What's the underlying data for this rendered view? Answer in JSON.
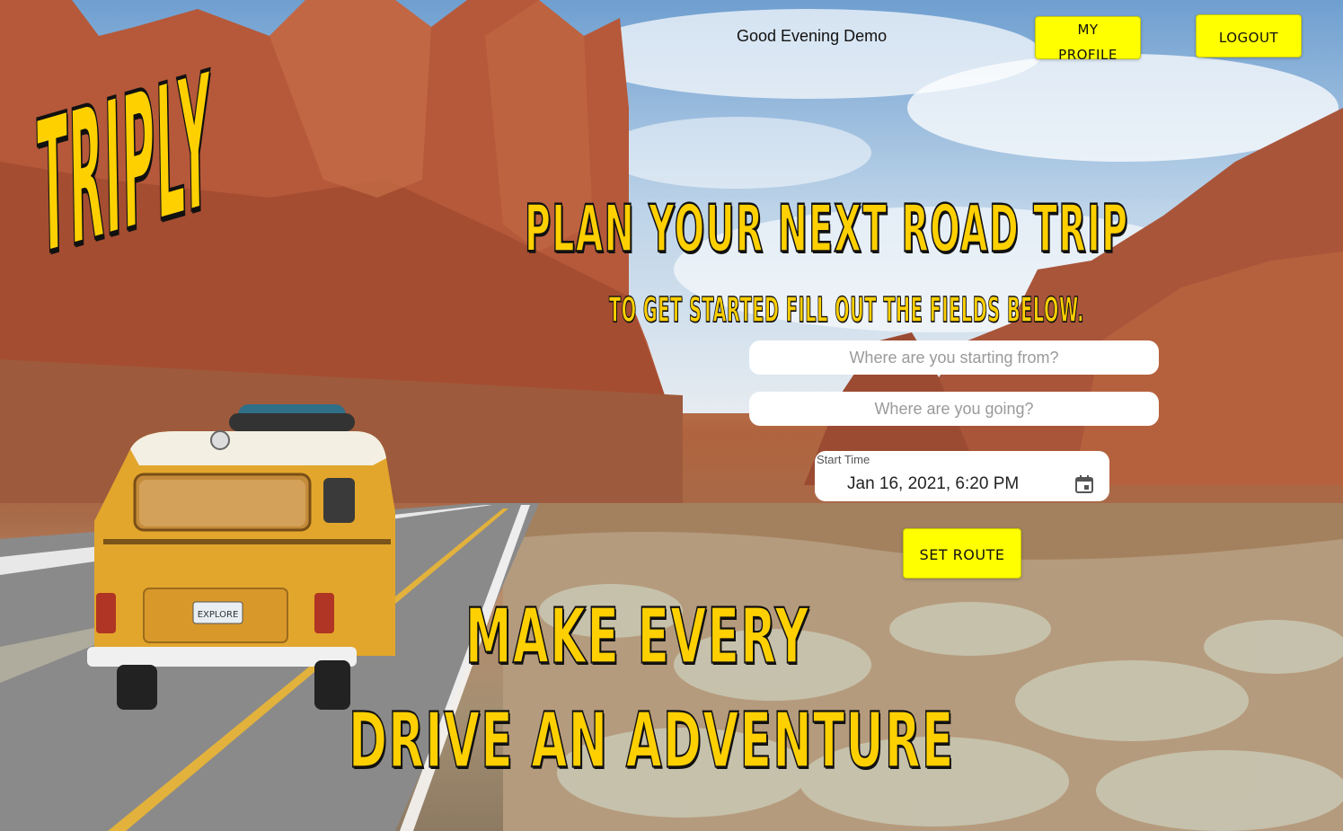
{
  "header": {
    "greeting": "Good Evening Demo",
    "profile_label": "MY PROFILE",
    "logout_label": "LOGOUT"
  },
  "brand": {
    "logo_text": "TRIPLY"
  },
  "hero": {
    "headline": "PLAN YOUR NEXT ROAD TRIP",
    "subheadline": "TO GET STARTED FILL OUT THE FIELDS BELOW.",
    "tagline_line1": "MAKE EVERY",
    "tagline_line2": "DRIVE AN ADVENTURE"
  },
  "form": {
    "start_placeholder": "Where are you starting from?",
    "start_value": "",
    "destination_placeholder": "Where are you going?",
    "destination_value": "",
    "start_time_label": "Start Time",
    "start_time_value": "Jan 16, 2021, 6:20 PM",
    "calendar_icon": "calendar-icon",
    "submit_label": "SET ROUTE"
  },
  "background": {
    "van_plate": "EXPLORE"
  },
  "colors": {
    "accent_yellow": "#ffff00",
    "display_yellow": "#ffd000",
    "outline": "#111111"
  }
}
